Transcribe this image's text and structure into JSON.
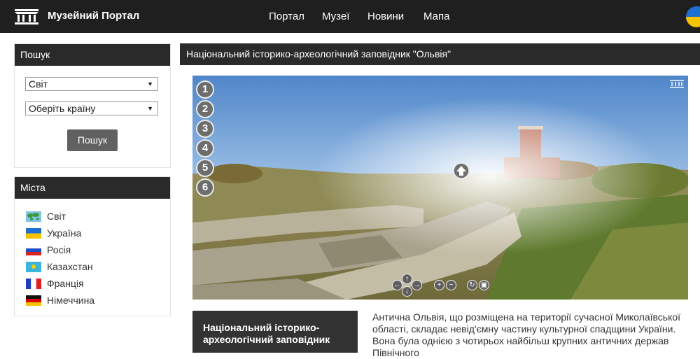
{
  "header": {
    "brand": "Музейний Портал",
    "nav": [
      "Портал",
      "Музеї",
      "Новини",
      "Мапа"
    ]
  },
  "search_panel": {
    "title": "Пошук",
    "world_select": "Світ",
    "country_select": "Оберіть країну",
    "search_button": "Пошук"
  },
  "cities_panel": {
    "title": "Міста",
    "items": [
      {
        "label": "Світ",
        "flag": "world-map"
      },
      {
        "label": "Україна",
        "flag": "ukraine"
      },
      {
        "label": "Росія",
        "flag": "russia"
      },
      {
        "label": "Казахстан",
        "flag": "kazakhstan"
      },
      {
        "label": "Франція",
        "flag": "france"
      },
      {
        "label": "Німеччина",
        "flag": "germany"
      }
    ]
  },
  "main": {
    "title": "Національний історико-археологічний заповідник \"Ольвія\"",
    "hotspots": [
      "1",
      "2",
      "3",
      "4",
      "5",
      "6"
    ],
    "info_box": "Національний історико-археологічний заповідник",
    "description": "Антична Ольвія, що розміщена на території сучасної Миколаївської області, складає невід'ємну частину культурної спадщини України. Вона була однією з чотирьох найбільш крупних античних держав Північного"
  },
  "colors": {
    "topbar": "#1f1f1f",
    "panel_header": "#2a2a2a",
    "button": "#616161",
    "info_box": "#333333"
  }
}
